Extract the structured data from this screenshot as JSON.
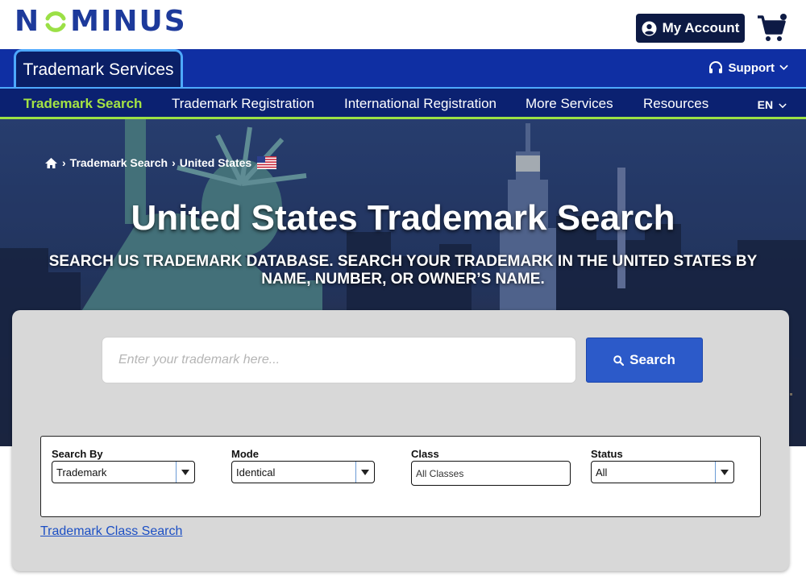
{
  "brand": {
    "logo_text_prefix": "N",
    "logo_text_suffix": "MINUS",
    "color": "#1d3a9b",
    "accent": "#9be046"
  },
  "header": {
    "account_label": "My Account",
    "account_icon": "user-circle-icon",
    "cart_icon": "shopping-cart-icon"
  },
  "service_bar": {
    "active_tab": "Trademark Services",
    "support_label": "Support",
    "support_icon": "headset-icon"
  },
  "nav": {
    "items": [
      {
        "label": "Trademark Search",
        "active": true
      },
      {
        "label": "Trademark Registration",
        "active": false
      },
      {
        "label": "International Registration",
        "active": false
      },
      {
        "label": "More Services",
        "active": false
      },
      {
        "label": "Resources",
        "active": false
      }
    ],
    "language": "EN"
  },
  "hero": {
    "breadcrumb": [
      "Trademark Search",
      "United States"
    ],
    "breadcrumb_separator": "›",
    "title": "United States Trademark Search",
    "subtitle": "SEARCH US TRADEMARK DATABASE. SEARCH YOUR TRADEMARK IN THE UNITED STATES BY NAME, NUMBER, OR OWNER’S NAME."
  },
  "search": {
    "placeholder": "Enter your trademark here...",
    "value": "",
    "button_label": "Search",
    "button_color": "#2c5ac9"
  },
  "filters": {
    "search_by": {
      "label": "Search By",
      "value": "Trademark"
    },
    "mode": {
      "label": "Mode",
      "value": "Identical"
    },
    "class": {
      "label": "Class",
      "placeholder": "All Classes"
    },
    "status": {
      "label": "Status",
      "value": "All"
    }
  },
  "class_search_link": "Trademark Class Search"
}
